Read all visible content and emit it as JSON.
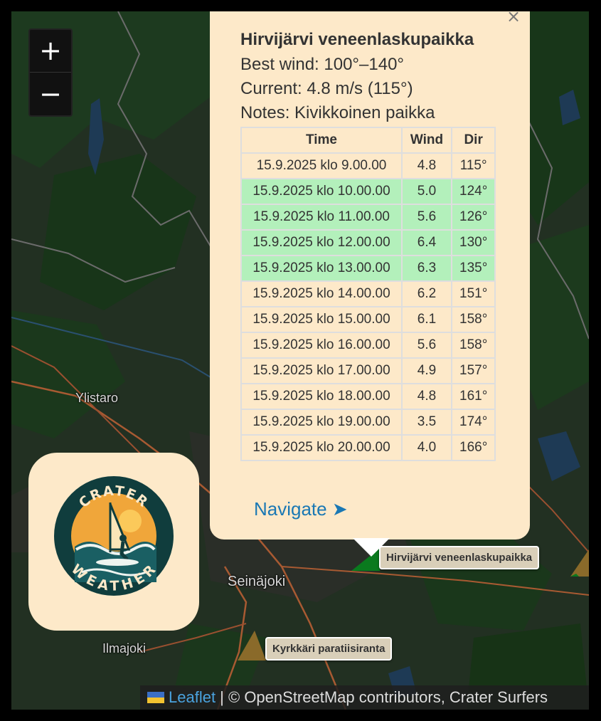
{
  "map": {
    "places": [
      "Ylistaro",
      "Seinäjoki",
      "Ilmajoki"
    ],
    "zoom_in_label": "+",
    "zoom_out_label": "−"
  },
  "logo": {
    "top_text": "CRATER",
    "bottom_text": "WEATHER"
  },
  "popup": {
    "close_label": "×",
    "title": "Hirvijärvi veneenlaskupaikka",
    "best_wind": "Best wind: 100°–140°",
    "current": "Current: 4.8 m/s (115°)",
    "notes": "Notes: Kivikkoinen paikka",
    "table": {
      "headers": [
        "Time",
        "Wind",
        "Dir"
      ],
      "rows": [
        {
          "time": "15.9.2025 klo 9.00.00",
          "wind": "4.8",
          "dir": "115°",
          "good": false
        },
        {
          "time": "15.9.2025 klo 10.00.00",
          "wind": "5.0",
          "dir": "124°",
          "good": true
        },
        {
          "time": "15.9.2025 klo 11.00.00",
          "wind": "5.6",
          "dir": "126°",
          "good": true
        },
        {
          "time": "15.9.2025 klo 12.00.00",
          "wind": "6.4",
          "dir": "130°",
          "good": true
        },
        {
          "time": "15.9.2025 klo 13.00.00",
          "wind": "6.3",
          "dir": "135°",
          "good": true
        },
        {
          "time": "15.9.2025 klo 14.00.00",
          "wind": "6.2",
          "dir": "151°",
          "good": false
        },
        {
          "time": "15.9.2025 klo 15.00.00",
          "wind": "6.1",
          "dir": "158°",
          "good": false
        },
        {
          "time": "15.9.2025 klo 16.00.00",
          "wind": "5.6",
          "dir": "158°",
          "good": false
        },
        {
          "time": "15.9.2025 klo 17.00.00",
          "wind": "4.9",
          "dir": "157°",
          "good": false
        },
        {
          "time": "15.9.2025 klo 18.00.00",
          "wind": "4.8",
          "dir": "161°",
          "good": false
        },
        {
          "time": "15.9.2025 klo 19.00.00",
          "wind": "3.5",
          "dir": "174°",
          "good": false
        },
        {
          "time": "15.9.2025 klo 20.00.00",
          "wind": "4.0",
          "dir": "166°",
          "good": false
        }
      ]
    },
    "navigate": "Navigate ➤"
  },
  "markers": [
    {
      "label": "Hirvijärvi veneenlaskupaikka",
      "color": "#0a7a1e"
    },
    {
      "label": "Kyrkkäri paratiisiranta",
      "color": "#8a6a2a"
    }
  ],
  "attribution": {
    "link": "Leaflet",
    "text": " | © OpenStreetMap contributors, Crater Surfers"
  },
  "colors": {
    "popup_bg": "#fde9c9",
    "good_row": "#b3f0bb",
    "link": "#1a78b4"
  }
}
